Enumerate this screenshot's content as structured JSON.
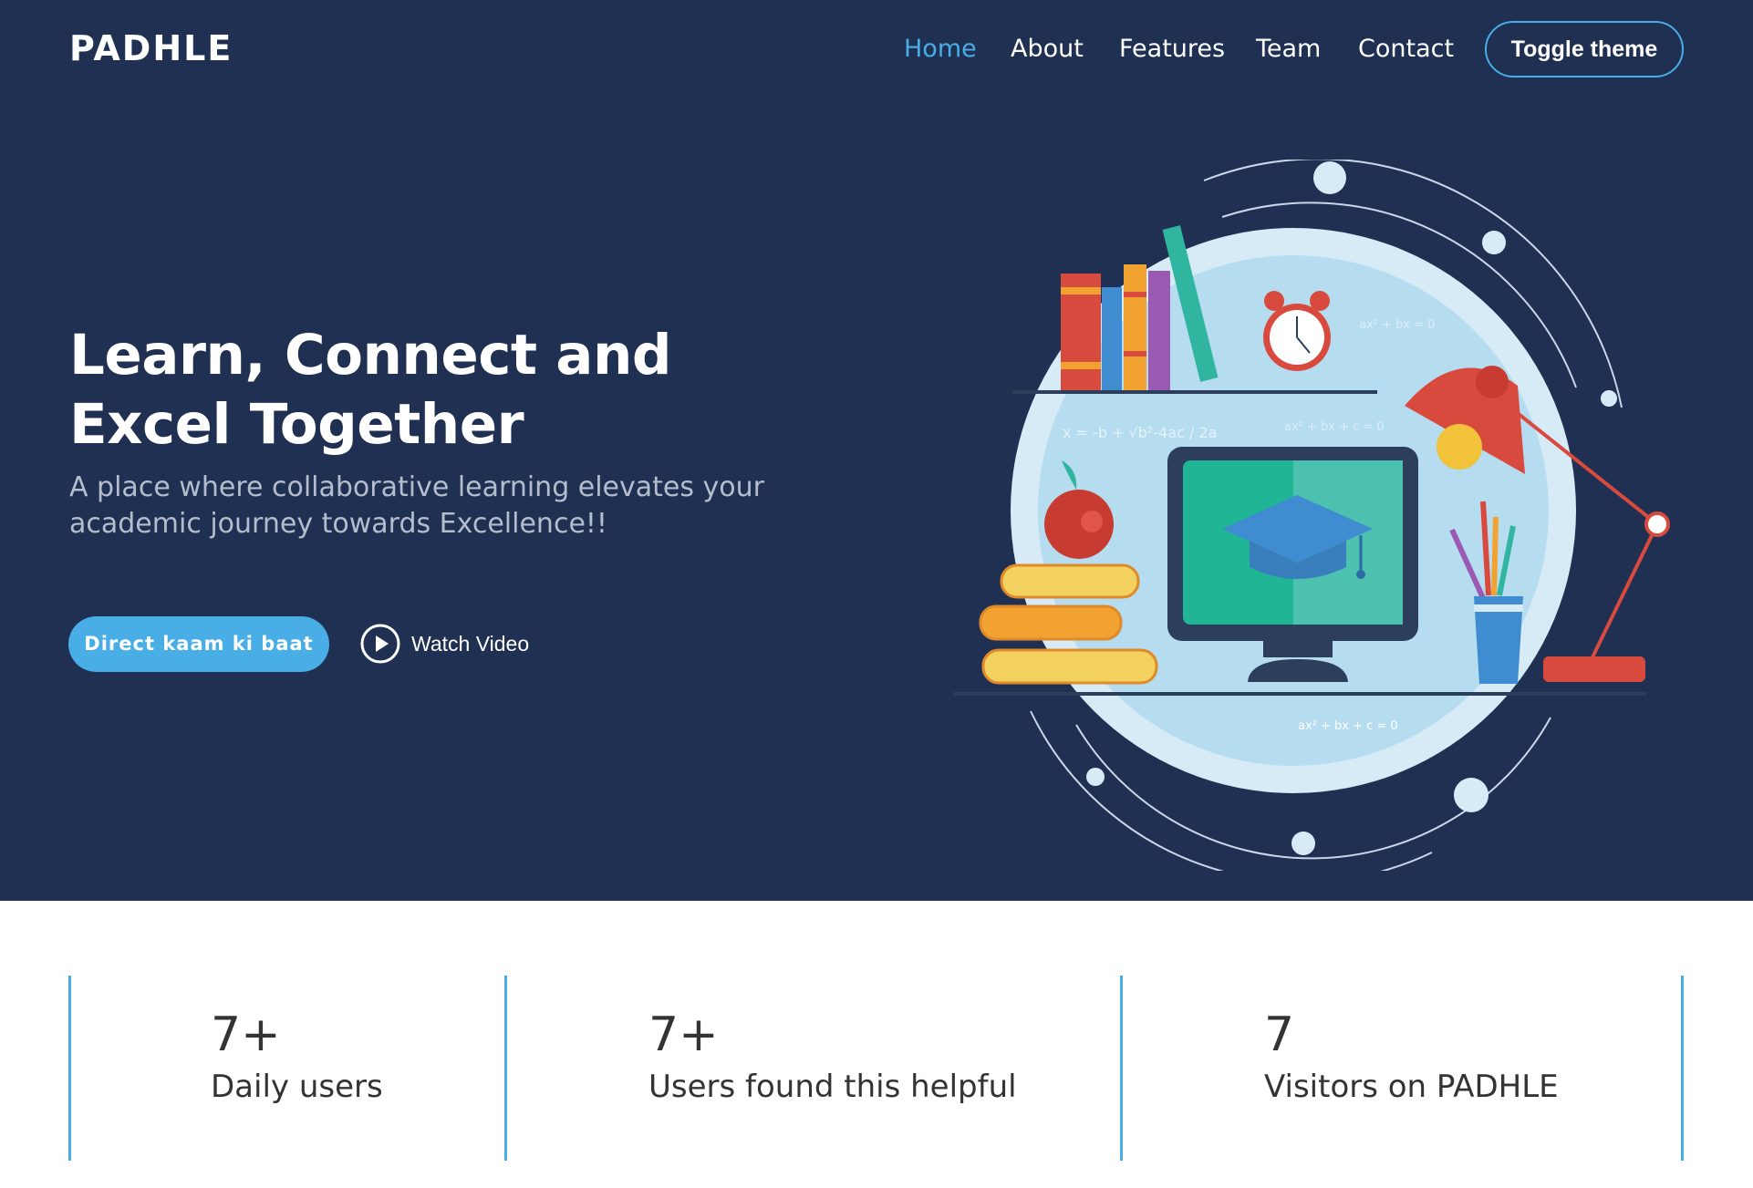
{
  "brand": {
    "logo": "PADHLE"
  },
  "nav": {
    "items": [
      {
        "label": "Home",
        "active": true
      },
      {
        "label": "About",
        "active": false
      },
      {
        "label": "Features",
        "active": false
      },
      {
        "label": "Team",
        "active": false
      },
      {
        "label": "Contact",
        "active": false
      }
    ],
    "toggle_label": "Toggle theme"
  },
  "hero": {
    "title_line1": "Learn, Connect and",
    "title_line2": "Excel Together",
    "subtitle": "A place where collaborative learning elevates your academic journey towards Excellence!!",
    "cta_label": "Direct kaam ki baat",
    "watch_label": "Watch Video"
  },
  "illustration": {
    "formula_quadratic": "x = -b + √b²-4ac / 2a",
    "formula_eq_1": "ax² + bx = 0",
    "formula_eq_2": "ax² + bx + c = 0",
    "formula_eq_3": "ax² + bx + c = 0"
  },
  "stats": [
    {
      "value": "7+",
      "label": "Daily users"
    },
    {
      "value": "7+",
      "label": "Users found this helpful"
    },
    {
      "value": "7",
      "label": "Visitors on PADHLE"
    }
  ],
  "colors": {
    "hero_bg": "#1f3052",
    "accent": "#49aee6",
    "stat_text": "#333333"
  }
}
